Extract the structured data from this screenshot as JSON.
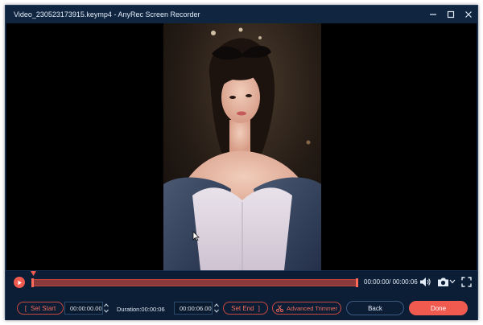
{
  "window": {
    "title": "Video_230523173915.keymp4  -  AnyRec Screen Recorder"
  },
  "timeline": {
    "current_time": "00:00:00",
    "total_time": "00:00:06",
    "time_display": "00:00:00/ 00:00:06"
  },
  "controls": {
    "set_start_label": "Set Start",
    "start_time": "00:00:00.00",
    "duration_label": "Duration:00:00:06",
    "end_time": "00:00:06.00",
    "set_end_label": "Set End",
    "advanced_trimmer_label": "Advanced Trimmer",
    "back_label": "Back",
    "done_label": "Done"
  },
  "colors": {
    "accent": "#f05a4f",
    "window_bg": "#0c1e35",
    "title_bg": "#0f2540"
  },
  "icons": [
    "minimize-icon",
    "maximize-icon",
    "close-icon",
    "play-icon",
    "volume-icon",
    "camera-icon",
    "chevron-down-icon",
    "fullscreen-icon",
    "scissors-icon"
  ]
}
